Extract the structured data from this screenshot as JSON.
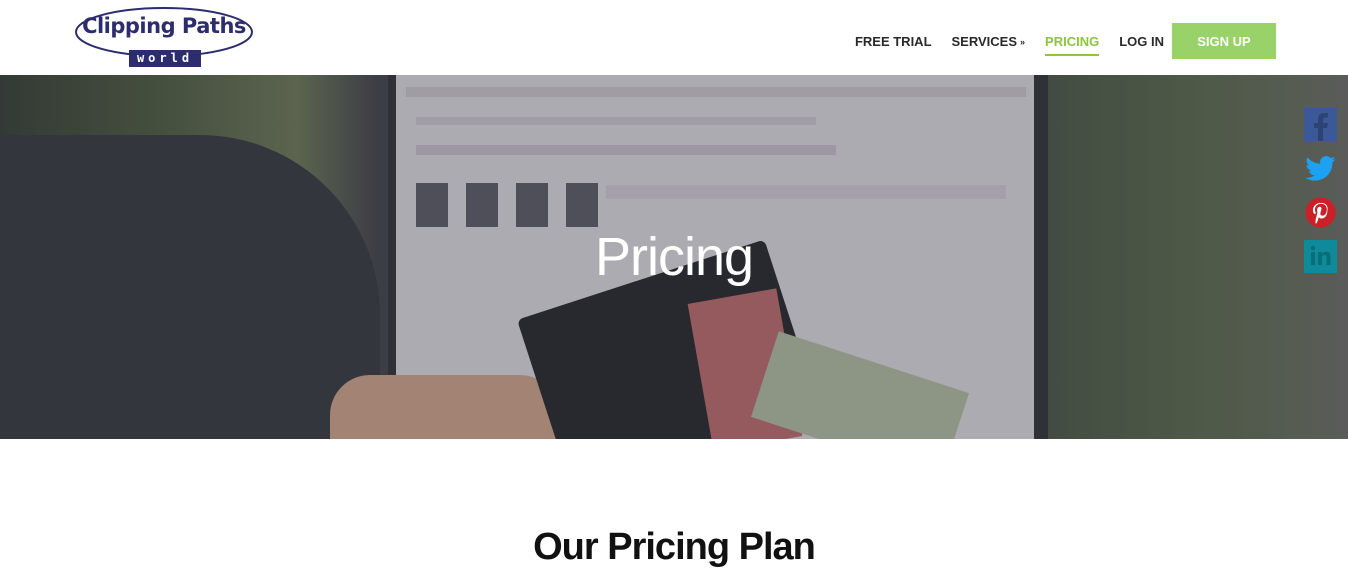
{
  "header": {
    "logo": {
      "title": "Clipping Paths",
      "subtitle": "world"
    },
    "nav": [
      {
        "label": "FREE TRIAL",
        "active": false
      },
      {
        "label": "SERVICES",
        "active": false,
        "has_dropdown": true
      },
      {
        "label": "PRICING",
        "active": true
      },
      {
        "label": "LOG IN",
        "active": false
      }
    ],
    "signup_label": "SIGN UP",
    "accent_color": "#8cc63f",
    "signup_color": "#9ad26a"
  },
  "hero": {
    "title": "Pricing"
  },
  "social": [
    {
      "name": "facebook",
      "icon": "facebook-icon",
      "color": "#3b5998"
    },
    {
      "name": "twitter",
      "icon": "twitter-icon",
      "color": "#1da1f2"
    },
    {
      "name": "pinterest",
      "icon": "pinterest-icon",
      "color": "#cb2027"
    },
    {
      "name": "linkedin",
      "icon": "linkedin-icon",
      "color": "#0e8a9a"
    }
  ],
  "main": {
    "section_title": "Our Pricing Plan"
  }
}
